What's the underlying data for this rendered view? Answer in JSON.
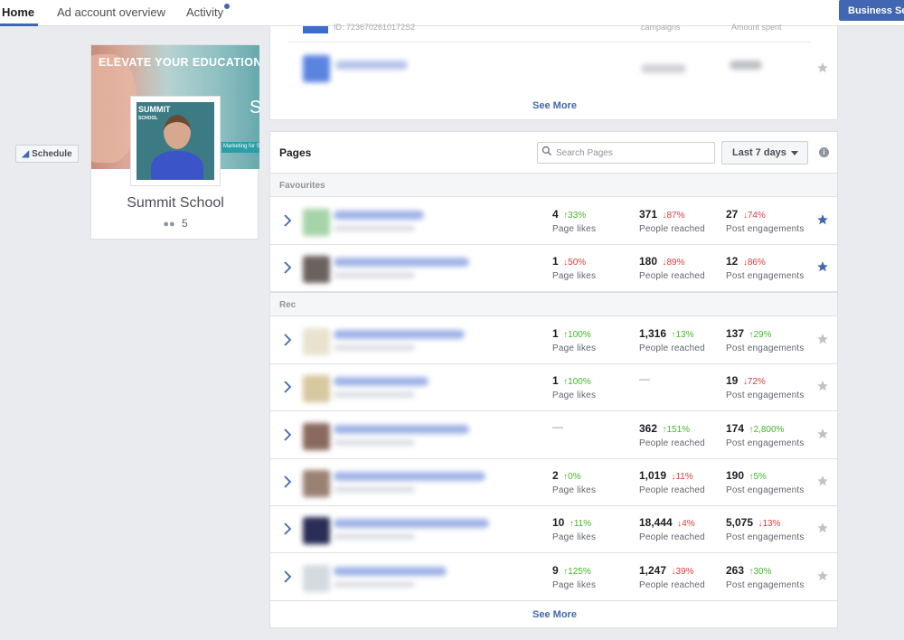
{
  "nav": {
    "tabs": [
      {
        "label": "Home"
      },
      {
        "label": "Ad account overview"
      },
      {
        "label": "Activity"
      }
    ],
    "business_button": "Business Se"
  },
  "schedule_button": "Schedule",
  "profile": {
    "cover_title": "ELEVATE YOUR EDUCATION",
    "cover_letter": "S",
    "cover_tagline": "Marketing for Sc",
    "avatar_logo": "SUMMIT",
    "avatar_logo_sub": "SCHOOL",
    "name": "Summit School",
    "members": "5"
  },
  "ad_card": {
    "id_text": "ID: 7236702610172S2",
    "col1": "campaigns",
    "col2": "Amount spent",
    "see_more": "See More"
  },
  "pages": {
    "title": "Pages",
    "search_placeholder": "Search Pages",
    "date_range": "Last 7 days",
    "info": "i",
    "see_more": "See More",
    "sections": {
      "favourites": "Favourites",
      "recent": "Rec"
    },
    "labels": {
      "likes": "Page likes",
      "reach": "People reached",
      "engagement": "Post engagements",
      "dash": "—"
    },
    "rows": [
      {
        "likes": "4",
        "likes_chg": "33%",
        "likes_dir": "up",
        "reach": "371",
        "reach_chg": "87%",
        "reach_dir": "down",
        "eng": "27",
        "eng_chg": "74%",
        "eng_dir": "down",
        "starred": true,
        "thumb_color": "#a6d4a9",
        "bar_width": 100
      },
      {
        "likes": "1",
        "likes_chg": "50%",
        "likes_dir": "down",
        "reach": "180",
        "reach_chg": "89%",
        "reach_dir": "down",
        "eng": "12",
        "eng_chg": "86%",
        "eng_dir": "down",
        "starred": true,
        "thumb_color": "#6a625d",
        "bar_width": 150
      },
      {
        "likes": "1",
        "likes_chg": "100%",
        "likes_dir": "up",
        "reach": "1,316",
        "reach_chg": "13%",
        "reach_dir": "up",
        "eng": "137",
        "eng_chg": "29%",
        "eng_dir": "up",
        "starred": false,
        "thumb_color": "#e8e2cf",
        "bar_width": 145
      },
      {
        "likes": "1",
        "likes_chg": "100%",
        "likes_dir": "up",
        "reach": "",
        "reach_chg": "",
        "reach_dir": "none",
        "eng": "19",
        "eng_chg": "72%",
        "eng_dir": "down",
        "starred": false,
        "thumb_color": "#d8c8a0",
        "bar_width": 105
      },
      {
        "likes": "",
        "likes_chg": "",
        "likes_dir": "none",
        "reach": "362",
        "reach_chg": "151%",
        "reach_dir": "up",
        "eng": "174",
        "eng_chg": "2,800%",
        "eng_dir": "up",
        "starred": false,
        "thumb_color": "#8a6a60",
        "bar_width": 150
      },
      {
        "likes": "2",
        "likes_chg": "0%",
        "likes_dir": "up",
        "reach": "1,019",
        "reach_chg": "11%",
        "reach_dir": "down",
        "eng": "190",
        "eng_chg": "5%",
        "eng_dir": "up",
        "starred": false,
        "thumb_color": "#9a8273",
        "bar_width": 168
      },
      {
        "likes": "10",
        "likes_chg": "11%",
        "likes_dir": "up",
        "reach": "18,444",
        "reach_chg": "4%",
        "reach_dir": "down",
        "eng": "5,075",
        "eng_chg": "13%",
        "eng_dir": "down",
        "starred": false,
        "thumb_color": "#2a2d55",
        "bar_width": 172
      },
      {
        "likes": "9",
        "likes_chg": "125%",
        "likes_dir": "up",
        "reach": "1,247",
        "reach_chg": "39%",
        "reach_dir": "down",
        "eng": "263",
        "eng_chg": "30%",
        "eng_dir": "up",
        "starred": false,
        "thumb_color": "#d5dae0",
        "bar_width": 125
      }
    ]
  },
  "colors": {
    "accent": "#4267b2",
    "up": "#42b72a",
    "down": "#e03b3b",
    "star_off": "#bec2c9"
  }
}
